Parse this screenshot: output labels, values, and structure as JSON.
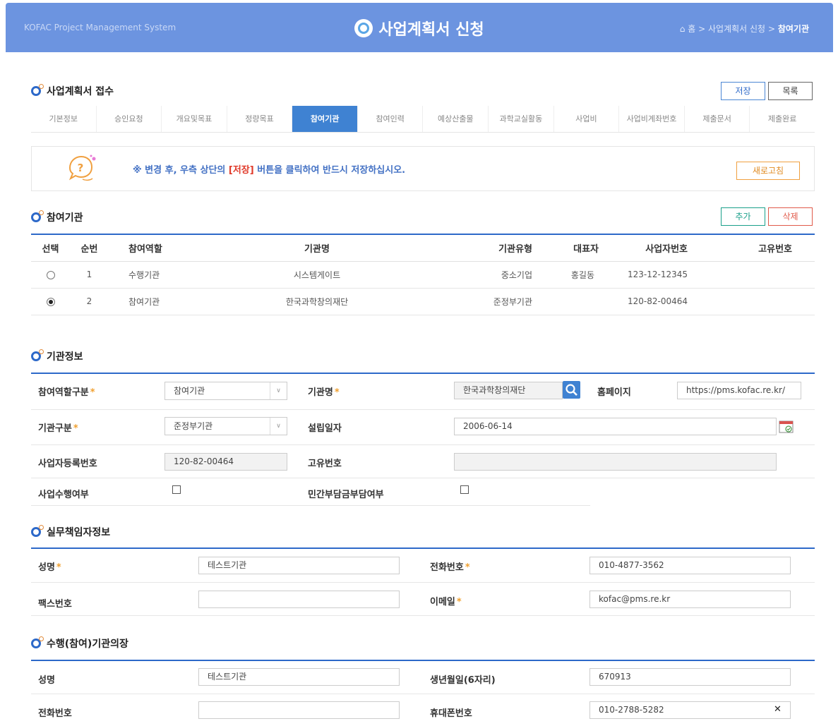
{
  "header": {
    "brand": "KOFAC Project Management System",
    "title": "사업계획서 신청",
    "breadcrumb": {
      "home": "홈",
      "sep": ">",
      "level1": "사업계획서 신청",
      "current": "참여기관"
    }
  },
  "reception": {
    "title": "사업계획서 접수",
    "save_label": "저장",
    "list_label": "목록"
  },
  "tabs": [
    "기본정보",
    "승인요청",
    "개요및목표",
    "정량목표",
    "참여기관",
    "참여인력",
    "예상산출물",
    "과학교실활동",
    "사업비",
    "사업비계좌번호",
    "제출문서",
    "제출완료"
  ],
  "active_tab": "참여기관",
  "notice": {
    "prefix": "※ 변경 후, 우측 상단의 ",
    "highlight": "[저장]",
    "suffix": " 버튼을 클릭하여 반드시 저장하십시오.",
    "refresh_label": "새로고침"
  },
  "participants": {
    "title": "참여기관",
    "add_label": "추가",
    "delete_label": "삭제",
    "columns": [
      "선택",
      "순번",
      "참여역할",
      "기관명",
      "기관유형",
      "대표자",
      "사업자번호",
      "고유번호"
    ],
    "rows": [
      {
        "selected": false,
        "no": "1",
        "role": "수행기관",
        "name": "시스템게이트",
        "type": "중소기업",
        "ceo": "홍길동",
        "bizno": "123-12-12345",
        "uid": ""
      },
      {
        "selected": true,
        "no": "2",
        "role": "참여기관",
        "name": "한국과학창의재단",
        "type": "준정부기관",
        "ceo": "",
        "bizno": "120-82-00464",
        "uid": ""
      }
    ]
  },
  "org": {
    "title": "기관정보",
    "role_label": "참여역할구분",
    "role_value": "참여기관",
    "name_label": "기관명",
    "name_value": "한국과학창의재단",
    "homepage_label": "홈페이지",
    "homepage_value": "https://pms.kofac.re.kr/",
    "type_label": "기관구분",
    "type_value": "준정부기관",
    "founded_label": "설립일자",
    "founded_value": "2006-06-14",
    "bizno_label": "사업자등록번호",
    "bizno_value": "120-82-00464",
    "uid_label": "고유번호",
    "uid_value": "",
    "perform_label": "사업수행여부",
    "private_label": "민간부담금부담여부",
    "required_mark": "*"
  },
  "manager": {
    "title": "실무책임자정보",
    "name_label": "성명",
    "name_value": "테스트기관",
    "phone_label": "전화번호",
    "phone_value": "010-4877-3562",
    "fax_label": "팩스번호",
    "fax_value": "",
    "email_label": "이메일",
    "email_value": "kofac@pms.re.kr"
  },
  "head": {
    "title": "수행(참여)기관의장",
    "name_label": "성명",
    "name_value": "테스트기관",
    "birth_label": "생년월일(6자리)",
    "birth_value": "670913",
    "phone_label": "전화번호",
    "phone_value": "",
    "mobile_label": "휴대폰번호",
    "mobile_value": "010-2788-5282",
    "clear_glyph": "✕"
  },
  "colors": {
    "header": "#6c94e0",
    "accent": "#2d69c9",
    "active_tab": "#3f82d2",
    "required": "#f0a030",
    "add": "#1aa08a",
    "delete": "#e05a4a"
  }
}
